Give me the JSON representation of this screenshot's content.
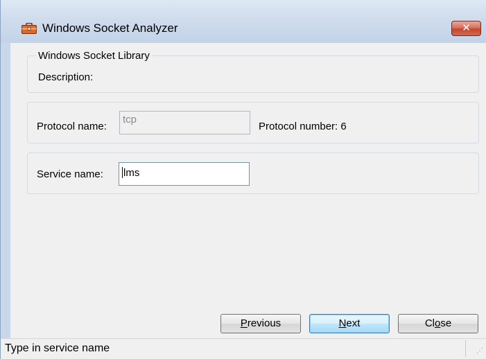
{
  "window": {
    "title": "Windows Socket Analyzer",
    "icon": "toolbox-icon",
    "close_label": "✕"
  },
  "library_panel": {
    "group_title": "Windows Socket Library",
    "description_label": "Description:"
  },
  "protocol_panel": {
    "protocol_name_label": "Protocol name:",
    "protocol_name_value": "tcp",
    "protocol_number_label": "Protocol number: 6"
  },
  "service_panel": {
    "service_name_label": "Service name:",
    "service_name_value": "lms"
  },
  "buttons": {
    "previous_accel": "P",
    "previous_rest": "revious",
    "next_accel": "N",
    "next_rest": "ext",
    "close_pre": "Cl",
    "close_accel": "o",
    "close_rest": "se"
  },
  "status": {
    "text": "Type in service name"
  },
  "colors": {
    "accent": "#3c7fb1",
    "close_button": "#c4462e",
    "panel_border": "#d5dbe3"
  }
}
